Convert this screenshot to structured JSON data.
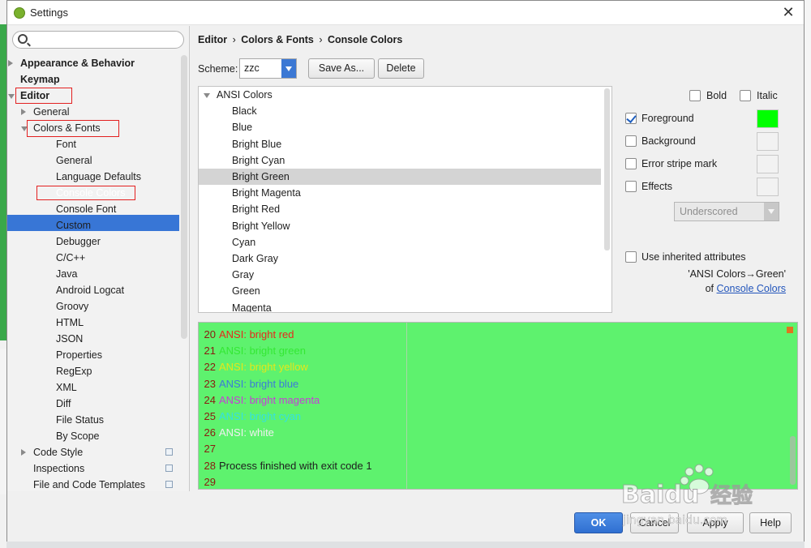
{
  "window": {
    "title": "Settings",
    "close_glyph": "✕"
  },
  "sidebar": {
    "search_placeholder": "",
    "items": [
      {
        "label": "Appearance & Behavior",
        "level": 0,
        "bold": true,
        "expander": "collapsed"
      },
      {
        "label": "Keymap",
        "level": 0,
        "bold": true,
        "expander": "none"
      },
      {
        "label": "Editor",
        "level": 0,
        "bold": true,
        "expander": "expanded"
      },
      {
        "label": "General",
        "level": 1,
        "bold": false,
        "expander": "collapsed"
      },
      {
        "label": "Colors & Fonts",
        "level": 1,
        "bold": false,
        "expander": "expanded"
      },
      {
        "label": "Font",
        "level": 2
      },
      {
        "label": "General",
        "level": 2
      },
      {
        "label": "Language Defaults",
        "level": 2
      },
      {
        "label": "Console Colors",
        "level": 2,
        "selected": true
      },
      {
        "label": "Console Font",
        "level": 2
      },
      {
        "label": "Custom",
        "level": 2
      },
      {
        "label": "Debugger",
        "level": 2
      },
      {
        "label": "C/C++",
        "level": 2
      },
      {
        "label": "Java",
        "level": 2
      },
      {
        "label": "Android Logcat",
        "level": 2
      },
      {
        "label": "Groovy",
        "level": 2
      },
      {
        "label": "HTML",
        "level": 2
      },
      {
        "label": "JSON",
        "level": 2
      },
      {
        "label": "Properties",
        "level": 2
      },
      {
        "label": "RegExp",
        "level": 2
      },
      {
        "label": "XML",
        "level": 2
      },
      {
        "label": "Diff",
        "level": 2
      },
      {
        "label": "File Status",
        "level": 2
      },
      {
        "label": "By Scope",
        "level": 2
      },
      {
        "label": "Code Style",
        "level": 1,
        "expander": "collapsed",
        "copy_icon": true
      },
      {
        "label": "Inspections",
        "level": 1,
        "copy_icon": true
      },
      {
        "label": "File and Code Templates",
        "level": 1,
        "copy_icon": true
      }
    ]
  },
  "breadcrumb": {
    "part1": "Editor",
    "sep1": "›",
    "part2": "Colors & Fonts",
    "sep2": "›",
    "part3": "Console Colors"
  },
  "scheme": {
    "label": "Scheme:",
    "value": "zzc",
    "save_as": "Save As...",
    "delete": "Delete"
  },
  "colors_list": {
    "root": "ANSI Colors",
    "items": [
      "Black",
      "Blue",
      "Bright Blue",
      "Bright Cyan",
      "Bright Green",
      "Bright Magenta",
      "Bright Red",
      "Bright Yellow",
      "Cyan",
      "Dark Gray",
      "Gray",
      "Green",
      "Magenta"
    ],
    "selected": "Bright Green"
  },
  "options": {
    "bold": "Bold",
    "italic": "Italic",
    "foreground": "Foreground",
    "background": "Background",
    "error_stripe": "Error stripe mark",
    "effects": "Effects",
    "effect_type": "Underscored",
    "use_inherited": "Use inherited attributes",
    "inherit_from": "'ANSI Colors→Green'",
    "inherit_of": "of",
    "inherit_link": "Console Colors",
    "foreground_color": "#00ff00",
    "foreground_checked": true
  },
  "preview": {
    "background": "#5ef26e",
    "lines": [
      {
        "num": "20",
        "text": "ANSI: bright red",
        "color": "#e8271c"
      },
      {
        "num": "21",
        "text": "ANSI: bright green",
        "color": "#34e834"
      },
      {
        "num": "22",
        "text": "ANSI: bright yellow",
        "color": "#e6e61a"
      },
      {
        "num": "23",
        "text": "ANSI: bright blue",
        "color": "#3c7bd9"
      },
      {
        "num": "24",
        "text": "ANSI: bright magenta",
        "color": "#c83cd8"
      },
      {
        "num": "25",
        "text": "ANSI: bright cyan",
        "color": "#35e0e0"
      },
      {
        "num": "26",
        "text": "ANSI: white",
        "color": "#f0f0f0"
      },
      {
        "num": "27",
        "text": "",
        "color": "#1e1e1e"
      },
      {
        "num": "28",
        "text": "Process finished with exit code 1",
        "color": "#1e1e1e"
      },
      {
        "num": "29",
        "text": "",
        "color": "#1e1e1e"
      }
    ]
  },
  "footer": {
    "ok": "OK",
    "cancel": "Cancel",
    "apply": "Apply",
    "help": "Help"
  },
  "watermark": {
    "brand": "Baidu",
    "cn": "经验",
    "url": "jingyan.baidu.com"
  }
}
